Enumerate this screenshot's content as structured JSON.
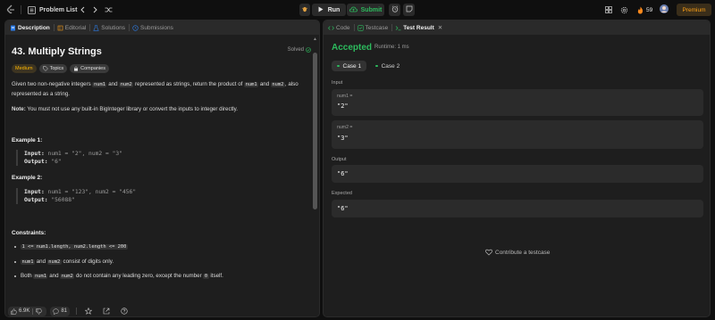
{
  "topbar": {
    "problem_list_label": "Problem List",
    "run_label": "Run",
    "submit_label": "Submit",
    "streak_count": "59",
    "premium_label": "Premium"
  },
  "left_tabs": [
    {
      "label": "Description"
    },
    {
      "label": "Editorial"
    },
    {
      "label": "Solutions"
    },
    {
      "label": "Submissions"
    }
  ],
  "problem": {
    "title": "43. Multiply Strings",
    "status": "Solved",
    "difficulty": "Medium",
    "topics_label": "Topics",
    "companies_label": "Companies",
    "desc_1": "Given two non-negative integers",
    "desc_num1": "num1",
    "desc_and": "and",
    "desc_num2": "num2",
    "desc_2": "represented as strings, return the product of",
    "desc_3": "also represented as a string.",
    "note_label": "Note:",
    "note_text": "You must not use any built-in BigInteger library or convert the inputs to integer directly.",
    "example1_title": "Example 1:",
    "example1_input_label": "Input:",
    "example1_input": "num1 = \"2\", num2 = \"3\"",
    "example1_output_label": "Output:",
    "example1_output": "\"6\"",
    "example2_title": "Example 2:",
    "example2_input_label": "Input:",
    "example2_input": "num1 = \"123\", num2 = \"456\"",
    "example2_output_label": "Output:",
    "example2_output": "\"56088\"",
    "constraints_title": "Constraints:",
    "constraint_1": "1 <= num1.length, num2.length <= 200",
    "constraint_2a": "num1",
    "constraint_2b": "and",
    "constraint_2c": "num2",
    "constraint_2d": "consist of digits only.",
    "constraint_3a": "Both",
    "constraint_3b": "num1",
    "constraint_3c": "and",
    "constraint_3d": "num2",
    "constraint_3e": "do not contain any leading zero, except the number",
    "constraint_3f": "0",
    "constraint_3g": "itself."
  },
  "footer": {
    "likes": "6.9K",
    "comments": "81"
  },
  "right_tabs": [
    {
      "label": "Code"
    },
    {
      "label": "Testcase"
    },
    {
      "label": "Test Result"
    }
  ],
  "result": {
    "status": "Accepted",
    "runtime": "Runtime: 1 ms",
    "case1": "Case 1",
    "case2": "Case 2",
    "input_label": "Input",
    "num1_key": "num1 =",
    "num1_value": "\"2\"",
    "num2_key": "num2 =",
    "num2_value": "\"3\"",
    "output_label": "Output",
    "output_value": "\"6\"",
    "expected_label": "Expected",
    "expected_value": "\"6\"",
    "contribute_label": "Contribute a testcase"
  },
  "colors": {
    "accent_green": "#2cbb5d",
    "medium_yellow": "#ffb800",
    "premium_orange": "#ffa116"
  }
}
